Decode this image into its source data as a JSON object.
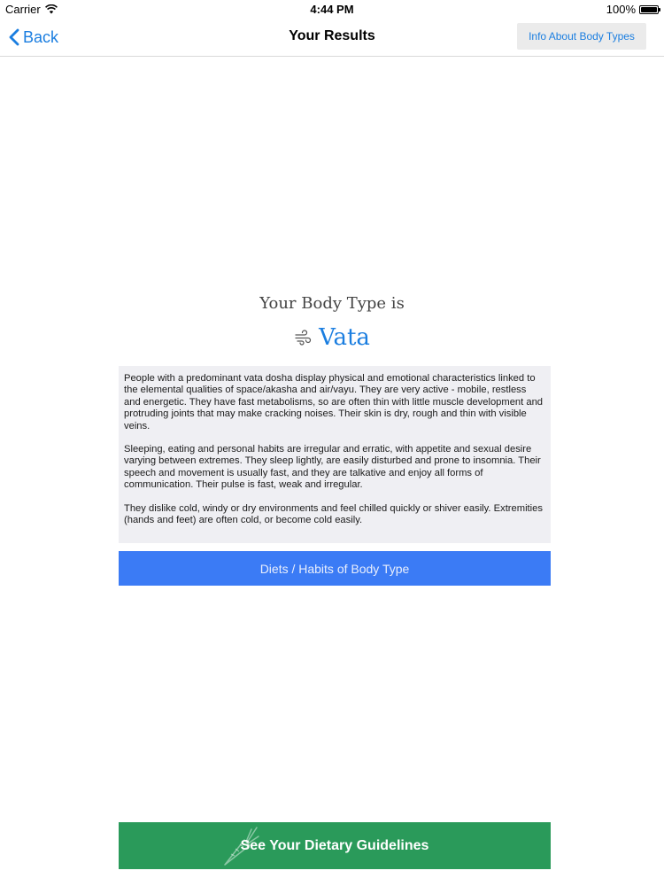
{
  "status_bar": {
    "carrier": "Carrier",
    "time": "4:44 PM",
    "battery": "100%",
    "battery_level": 1.0
  },
  "nav": {
    "back_label": "Back",
    "title": "Your Results",
    "info_button": "Info About Body Types"
  },
  "result": {
    "label": "Your Body Type is",
    "value": "Vata",
    "icon": "wind-icon"
  },
  "description": {
    "paragraphs": [
      "People with a predominant vata dosha display physical and emotional characteristics linked to the elemental qualities of space/akasha and air/vayu. They are very active - mobile, restless and energetic. They have fast metabolisms, so are often thin with little muscle development and protruding joints that may make cracking noises. Their skin is dry, rough and thin with visible veins.",
      "Sleeping, eating and personal habits are irregular and erratic, with appetite and sexual desire varying between extremes. They sleep lightly, are easily disturbed and prone to insomnia. Their speech and movement is usually fast, and they are talkative and enjoy all forms of communication. Their pulse is fast, weak and irregular.",
      "They dislike cold, windy or dry environments and feel chilled quickly or shiver easily. Extremities (hands and feet) are often cold, or become cold easily."
    ]
  },
  "buttons": {
    "diets": "Diets / Habits of Body Type",
    "guidelines": "See Your Dietary Guidelines",
    "guidelines_icon": "carrot-icon"
  },
  "colors": {
    "accent": "#1b7ee0",
    "diets_button": "#3b7bf5",
    "guidelines_button": "#2a9a5a",
    "description_bg": "#efeff3"
  }
}
